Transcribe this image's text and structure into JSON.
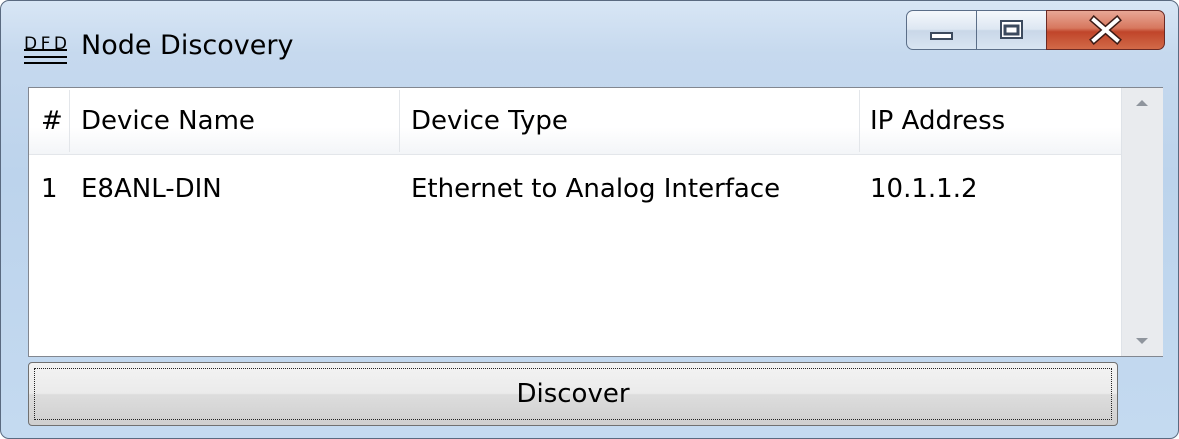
{
  "window": {
    "title": "Node Discovery",
    "icon": "dfd-app-icon",
    "icon_text": "DFD"
  },
  "caption_buttons": {
    "minimize_icon": "minimize-icon",
    "maximize_icon": "maximize-icon",
    "close_icon": "close-icon"
  },
  "table": {
    "columns": [
      "#",
      "Device Name",
      "Device Type",
      "IP Address"
    ],
    "rows": [
      {
        "index": "1",
        "device_name": "E8ANL-DIN",
        "device_type": "Ethernet to Analog Interface",
        "ip_address": "10.1.1.2"
      }
    ]
  },
  "scrollbar": {
    "up_icon": "scroll-up-icon",
    "down_icon": "scroll-down-icon"
  },
  "actions": {
    "discover_label": "Discover"
  },
  "colors": {
    "title_bar": "#c6d9ee",
    "close_button": "#c0452a",
    "list_background": "#ffffff"
  }
}
